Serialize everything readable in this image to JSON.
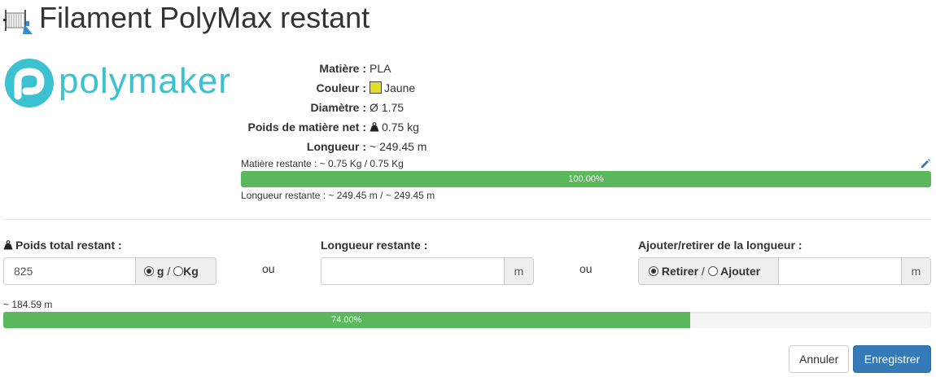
{
  "header": {
    "title": "Filament PolyMax restant"
  },
  "logo": {
    "text": "polymaker"
  },
  "specs": {
    "material_label": "Matière :",
    "material_value": "PLA",
    "color_label": "Couleur :",
    "color_value": "Jaune",
    "color_swatch": "#e3dc29",
    "diameter_label": "Diamètre :",
    "diameter_value": "Ø 1.75",
    "net_weight_label": "Poids de matière net :",
    "net_weight_value": "0.75 kg",
    "length_label": "Longueur :",
    "length_value": "~ 249.45 m"
  },
  "remaining": {
    "material_text": "Matière restante : ~ 0.75 Kg / 0.75 Kg",
    "progress_percent": 100,
    "progress_label": "100.00%",
    "length_text": "Longueur restante : ~ 249.45 m / ~ 249.45 m"
  },
  "form": {
    "weight_label": "Poids total restant :",
    "weight_value": "825",
    "unit_g": "g",
    "unit_sep": "/",
    "unit_kg": "Kg",
    "or1": "ou",
    "length_label": "Longueur restante :",
    "length_value": "",
    "length_unit": "m",
    "or2": "ou",
    "adjust_label": "Ajouter/retirer de la longueur :",
    "remove_label": "Retirer",
    "add_sep": "/",
    "add_label": "Ajouter",
    "adjust_value": "",
    "adjust_unit": "m"
  },
  "result": {
    "length_text": "~ 184.59 m",
    "progress_percent": 74,
    "progress_label": "74.00%"
  },
  "actions": {
    "cancel": "Annuler",
    "save": "Enregistrer"
  },
  "colors": {
    "progress": "#5cb85c",
    "primary": "#337ab7",
    "logo": "#3cc1d1"
  }
}
